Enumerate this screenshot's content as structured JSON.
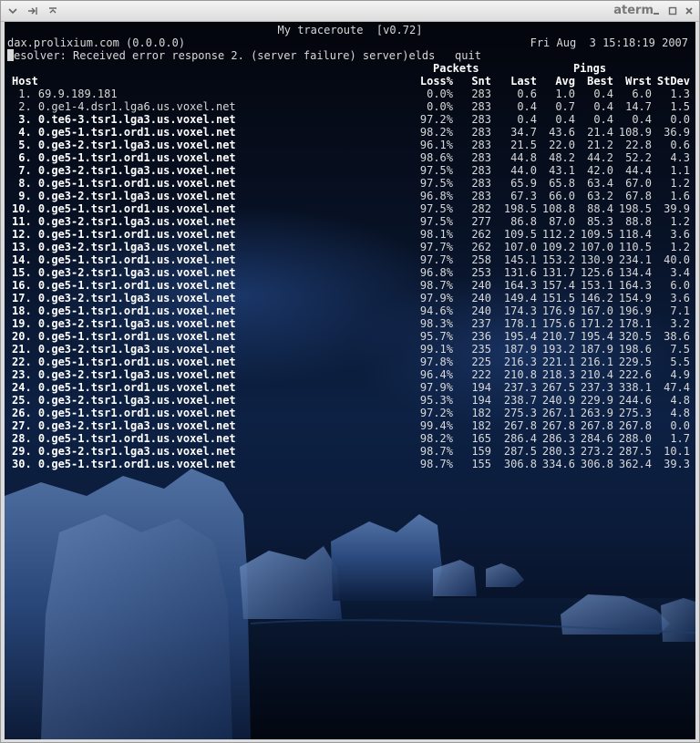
{
  "window": {
    "title": "aterm"
  },
  "terminal": {
    "title": "My traceroute  [v0.72]",
    "host_line": "dax.prolixium.com (0.0.0.0)",
    "datetime": "Fri Aug  3 15:18:19 2007",
    "status_prefix": "R",
    "status_line": "esolver: Received error response 2. (server failure) server)elds   quit",
    "group_packets": "Packets",
    "group_pings": "Pings",
    "columns": [
      "Host",
      "Loss%",
      "Snt",
      "Last",
      "Avg",
      "Best",
      "Wrst",
      "StDev"
    ],
    "rows": [
      {
        "host": " 1. 69.9.189.181",
        "loss": "0.0%",
        "snt": "283",
        "last": "0.6",
        "avg": "1.0",
        "best": "0.4",
        "wrst": "6.0",
        "stdev": "1.3"
      },
      {
        "host": " 2. 0.ge1-4.dsr1.lga6.us.voxel.net",
        "loss": "0.0%",
        "snt": "283",
        "last": "0.4",
        "avg": "0.7",
        "best": "0.4",
        "wrst": "14.7",
        "stdev": "1.5"
      },
      {
        "host": " 3. 0.te6-3.tsr1.lga3.us.voxel.net",
        "loss": "97.2%",
        "snt": "283",
        "last": "0.4",
        "avg": "0.4",
        "best": "0.4",
        "wrst": "0.4",
        "stdev": "0.0"
      },
      {
        "host": " 4. 0.ge5-1.tsr1.ord1.us.voxel.net",
        "loss": "98.2%",
        "snt": "283",
        "last": "34.7",
        "avg": "43.6",
        "best": "21.4",
        "wrst": "108.9",
        "stdev": "36.9"
      },
      {
        "host": " 5. 0.ge3-2.tsr1.lga3.us.voxel.net",
        "loss": "96.1%",
        "snt": "283",
        "last": "21.5",
        "avg": "22.0",
        "best": "21.2",
        "wrst": "22.8",
        "stdev": "0.6"
      },
      {
        "host": " 6. 0.ge5-1.tsr1.ord1.us.voxel.net",
        "loss": "98.6%",
        "snt": "283",
        "last": "44.8",
        "avg": "48.2",
        "best": "44.2",
        "wrst": "52.2",
        "stdev": "4.3"
      },
      {
        "host": " 7. 0.ge3-2.tsr1.lga3.us.voxel.net",
        "loss": "97.5%",
        "snt": "283",
        "last": "44.0",
        "avg": "43.1",
        "best": "42.0",
        "wrst": "44.4",
        "stdev": "1.1"
      },
      {
        "host": " 8. 0.ge5-1.tsr1.ord1.us.voxel.net",
        "loss": "97.5%",
        "snt": "283",
        "last": "65.9",
        "avg": "65.8",
        "best": "63.4",
        "wrst": "67.0",
        "stdev": "1.2"
      },
      {
        "host": " 9. 0.ge3-2.tsr1.lga3.us.voxel.net",
        "loss": "96.8%",
        "snt": "283",
        "last": "67.3",
        "avg": "66.0",
        "best": "63.2",
        "wrst": "67.8",
        "stdev": "1.6"
      },
      {
        "host": "10. 0.ge5-1.tsr1.ord1.us.voxel.net",
        "loss": "97.5%",
        "snt": "282",
        "last": "198.5",
        "avg": "108.8",
        "best": "88.4",
        "wrst": "198.5",
        "stdev": "39.9"
      },
      {
        "host": "11. 0.ge3-2.tsr1.lga3.us.voxel.net",
        "loss": "97.5%",
        "snt": "277",
        "last": "86.8",
        "avg": "87.0",
        "best": "85.3",
        "wrst": "88.8",
        "stdev": "1.2"
      },
      {
        "host": "12. 0.ge5-1.tsr1.ord1.us.voxel.net",
        "loss": "98.1%",
        "snt": "262",
        "last": "109.5",
        "avg": "112.2",
        "best": "109.5",
        "wrst": "118.4",
        "stdev": "3.6"
      },
      {
        "host": "13. 0.ge3-2.tsr1.lga3.us.voxel.net",
        "loss": "97.7%",
        "snt": "262",
        "last": "107.0",
        "avg": "109.2",
        "best": "107.0",
        "wrst": "110.5",
        "stdev": "1.2"
      },
      {
        "host": "14. 0.ge5-1.tsr1.ord1.us.voxel.net",
        "loss": "97.7%",
        "snt": "258",
        "last": "145.1",
        "avg": "153.2",
        "best": "130.9",
        "wrst": "234.1",
        "stdev": "40.0"
      },
      {
        "host": "15. 0.ge3-2.tsr1.lga3.us.voxel.net",
        "loss": "96.8%",
        "snt": "253",
        "last": "131.6",
        "avg": "131.7",
        "best": "125.6",
        "wrst": "134.4",
        "stdev": "3.4"
      },
      {
        "host": "16. 0.ge5-1.tsr1.ord1.us.voxel.net",
        "loss": "98.7%",
        "snt": "240",
        "last": "164.3",
        "avg": "157.4",
        "best": "153.1",
        "wrst": "164.3",
        "stdev": "6.0"
      },
      {
        "host": "17. 0.ge3-2.tsr1.lga3.us.voxel.net",
        "loss": "97.9%",
        "snt": "240",
        "last": "149.4",
        "avg": "151.5",
        "best": "146.2",
        "wrst": "154.9",
        "stdev": "3.6"
      },
      {
        "host": "18. 0.ge5-1.tsr1.ord1.us.voxel.net",
        "loss": "94.6%",
        "snt": "240",
        "last": "174.3",
        "avg": "176.9",
        "best": "167.0",
        "wrst": "196.9",
        "stdev": "7.1"
      },
      {
        "host": "19. 0.ge3-2.tsr1.lga3.us.voxel.net",
        "loss": "98.3%",
        "snt": "237",
        "last": "178.1",
        "avg": "175.6",
        "best": "171.2",
        "wrst": "178.1",
        "stdev": "3.2"
      },
      {
        "host": "20. 0.ge5-1.tsr1.ord1.us.voxel.net",
        "loss": "95.7%",
        "snt": "236",
        "last": "195.4",
        "avg": "210.7",
        "best": "195.4",
        "wrst": "320.5",
        "stdev": "38.6"
      },
      {
        "host": "21. 0.ge3-2.tsr1.lga3.us.voxel.net",
        "loss": "99.1%",
        "snt": "235",
        "last": "187.9",
        "avg": "193.2",
        "best": "187.9",
        "wrst": "198.6",
        "stdev": "7.5"
      },
      {
        "host": "22. 0.ge5-1.tsr1.ord1.us.voxel.net",
        "loss": "97.8%",
        "snt": "225",
        "last": "216.3",
        "avg": "221.1",
        "best": "216.1",
        "wrst": "229.5",
        "stdev": "5.5"
      },
      {
        "host": "23. 0.ge3-2.tsr1.lga3.us.voxel.net",
        "loss": "96.4%",
        "snt": "222",
        "last": "210.8",
        "avg": "218.3",
        "best": "210.4",
        "wrst": "222.6",
        "stdev": "4.9"
      },
      {
        "host": "24. 0.ge5-1.tsr1.ord1.us.voxel.net",
        "loss": "97.9%",
        "snt": "194",
        "last": "237.3",
        "avg": "267.5",
        "best": "237.3",
        "wrst": "338.1",
        "stdev": "47.4"
      },
      {
        "host": "25. 0.ge3-2.tsr1.lga3.us.voxel.net",
        "loss": "95.3%",
        "snt": "194",
        "last": "238.7",
        "avg": "240.9",
        "best": "229.9",
        "wrst": "244.6",
        "stdev": "4.8"
      },
      {
        "host": "26. 0.ge5-1.tsr1.ord1.us.voxel.net",
        "loss": "97.2%",
        "snt": "182",
        "last": "275.3",
        "avg": "267.1",
        "best": "263.9",
        "wrst": "275.3",
        "stdev": "4.8"
      },
      {
        "host": "27. 0.ge3-2.tsr1.lga3.us.voxel.net",
        "loss": "99.4%",
        "snt": "182",
        "last": "267.8",
        "avg": "267.8",
        "best": "267.8",
        "wrst": "267.8",
        "stdev": "0.0"
      },
      {
        "host": "28. 0.ge5-1.tsr1.ord1.us.voxel.net",
        "loss": "98.2%",
        "snt": "165",
        "last": "286.4",
        "avg": "286.3",
        "best": "284.6",
        "wrst": "288.0",
        "stdev": "1.7"
      },
      {
        "host": "29. 0.ge3-2.tsr1.lga3.us.voxel.net",
        "loss": "98.7%",
        "snt": "159",
        "last": "287.5",
        "avg": "280.3",
        "best": "273.2",
        "wrst": "287.5",
        "stdev": "10.1"
      },
      {
        "host": "30. 0.ge5-1.tsr1.ord1.us.voxel.net",
        "loss": "98.7%",
        "snt": "155",
        "last": "306.8",
        "avg": "334.6",
        "best": "306.8",
        "wrst": "362.4",
        "stdev": "39.3"
      }
    ]
  }
}
